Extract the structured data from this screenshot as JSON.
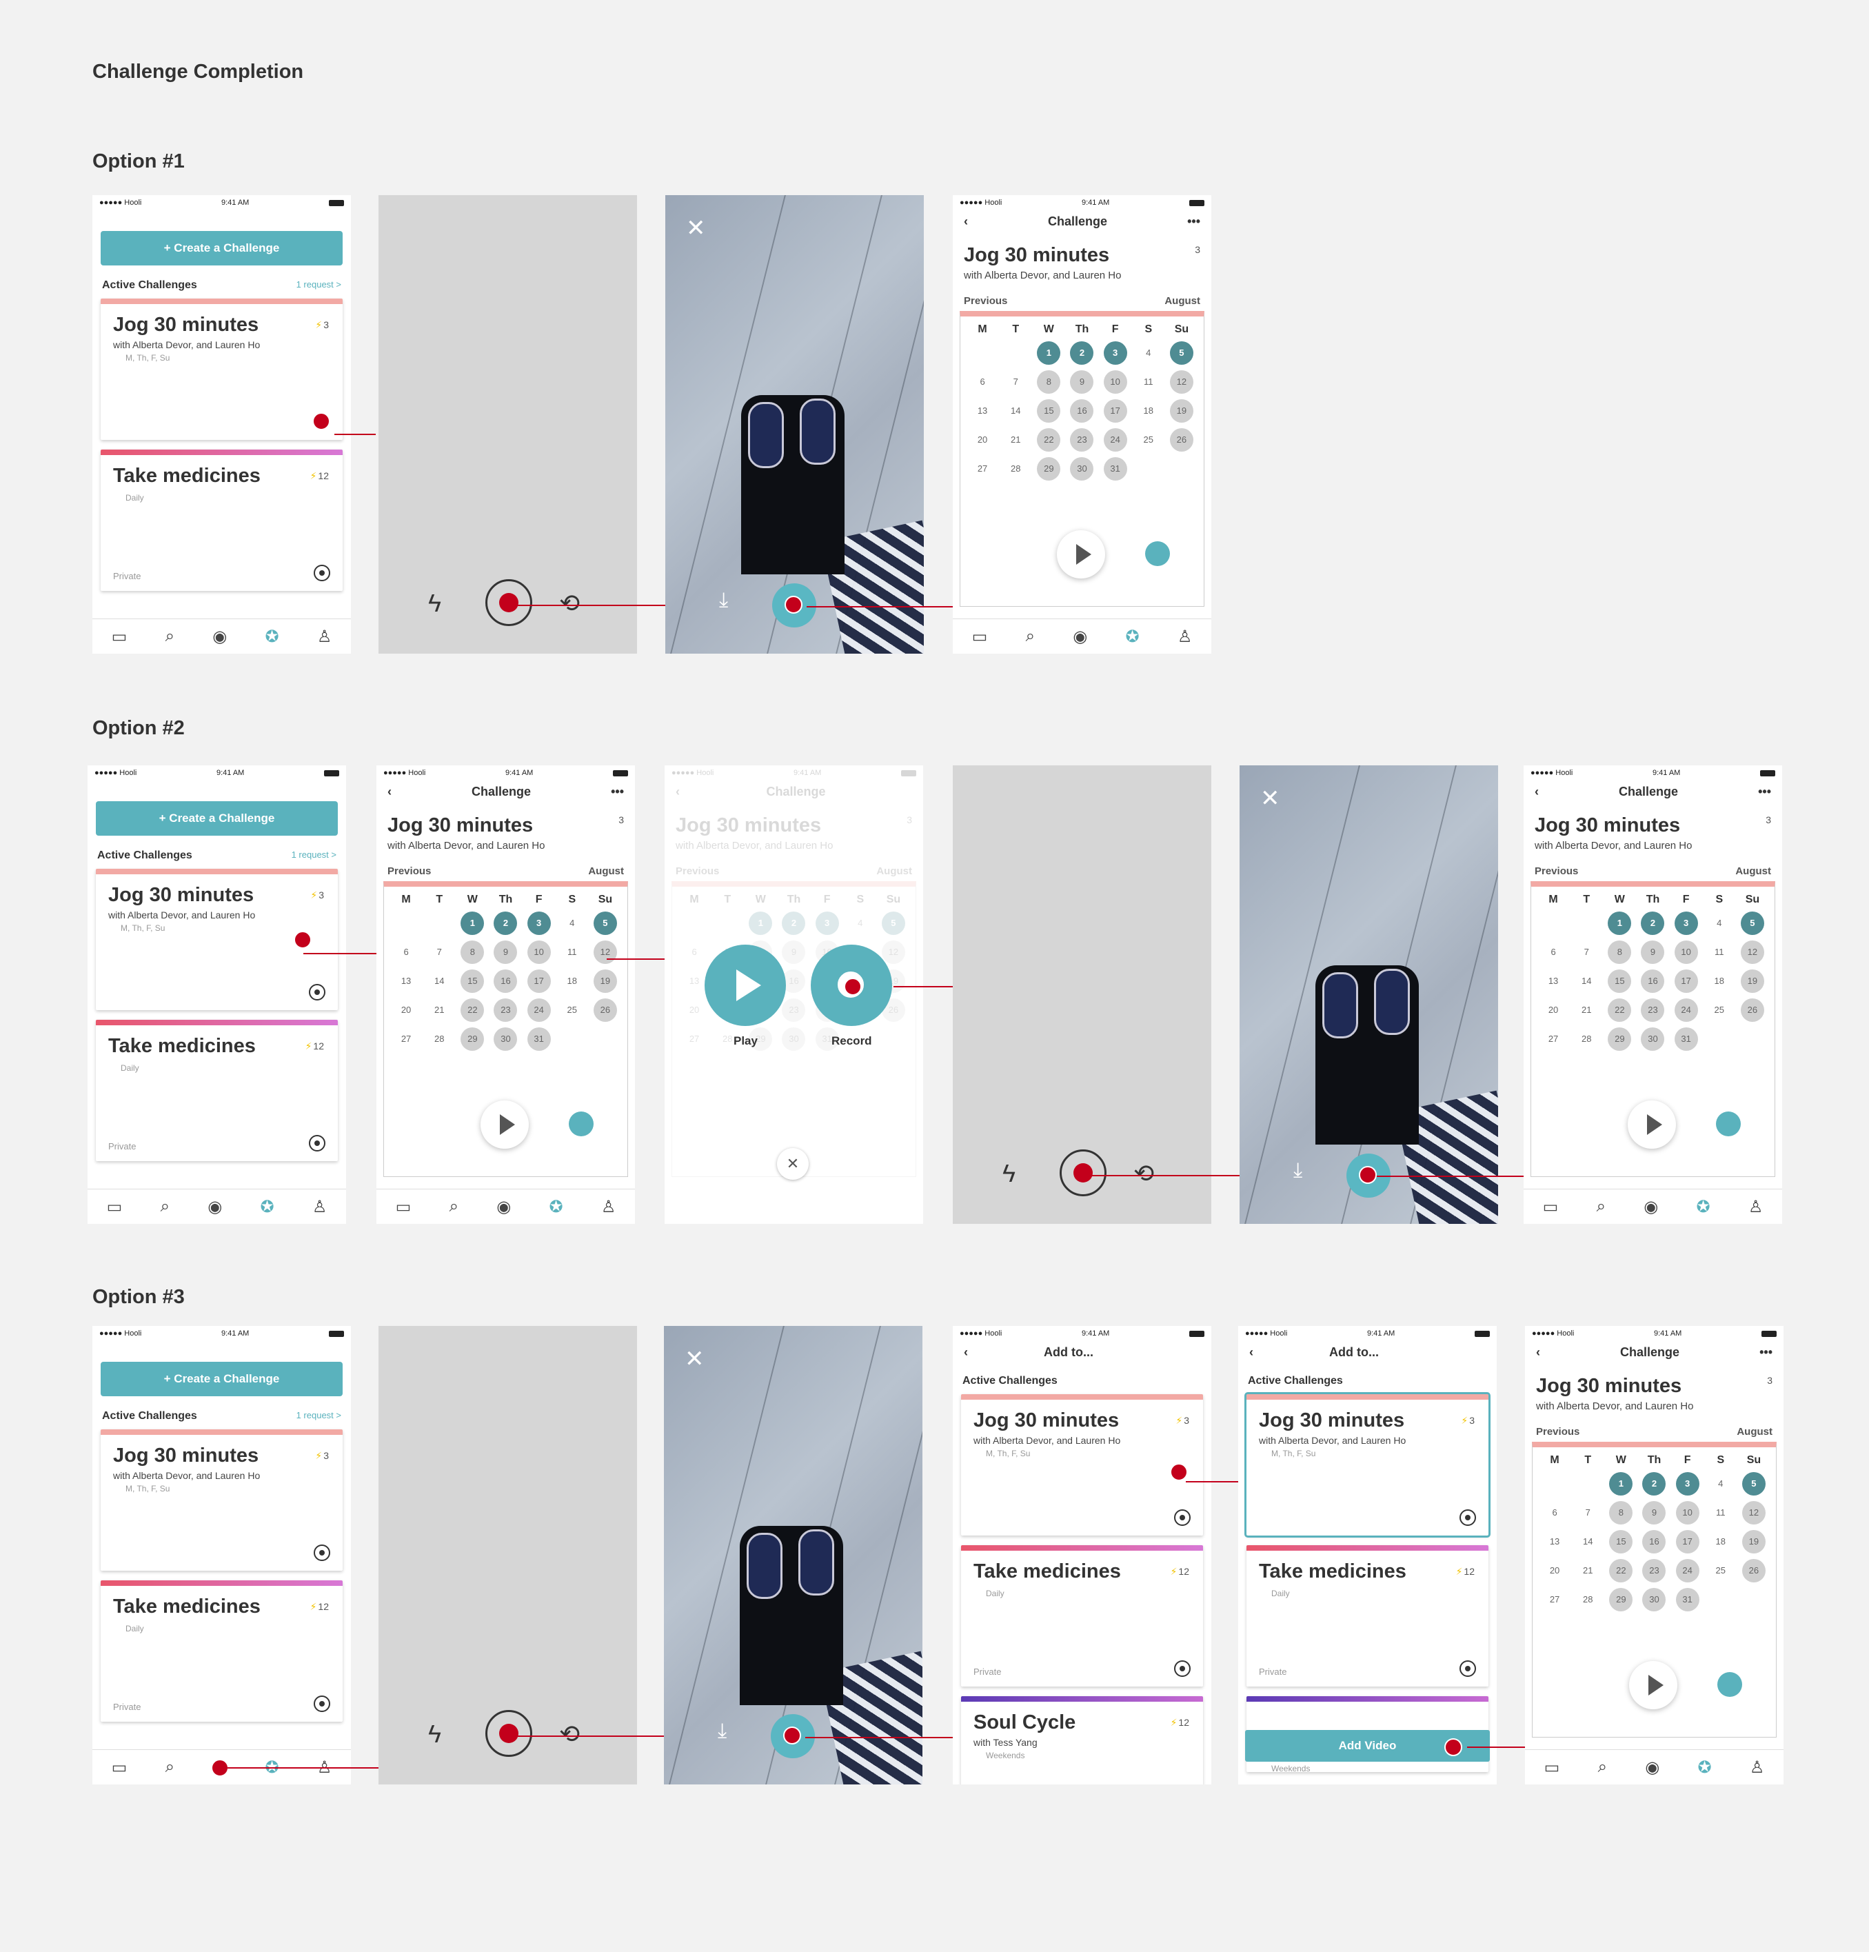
{
  "page": {
    "title": "Challenge Completion"
  },
  "options": [
    "Option #1",
    "Option #2",
    "Option #3"
  ],
  "status": {
    "carrier": "●●●●● Hooli ",
    "time": "9:41 AM"
  },
  "home": {
    "create": "+ Create a Challenge",
    "section": "Active Challenges",
    "requests": "1 request >"
  },
  "jog": {
    "title": "Jog 30 minutes",
    "with": "with Alberta Devor, and Lauren Ho",
    "days": "M, Th, F, Su",
    "points": "3"
  },
  "meds": {
    "title": "Take medicines",
    "schedule": "Daily",
    "points": "12",
    "privacy": "Private"
  },
  "soul": {
    "title": "Soul Cycle",
    "with": "with Tess Yang",
    "schedule": "Weekends",
    "points": "12"
  },
  "challenge": {
    "nav_title": "Challenge",
    "previous": "Previous",
    "month": "August"
  },
  "calendar": {
    "headers": [
      "M",
      "T",
      "W",
      "Th",
      "F",
      "S",
      "Su"
    ],
    "days": [
      "",
      "",
      "1",
      "2",
      "3",
      "4",
      "5",
      "6",
      "7",
      "8",
      "9",
      "10",
      "11",
      "12",
      "13",
      "14",
      "15",
      "16",
      "17",
      "18",
      "19",
      "20",
      "21",
      "22",
      "23",
      "24",
      "25",
      "26",
      "27",
      "28",
      "29",
      "30",
      "31",
      "",
      "",
      ""
    ],
    "completed": [
      "1",
      "2",
      "3",
      "5"
    ]
  },
  "popup": {
    "play": "Play",
    "record": "Record"
  },
  "addto": {
    "nav_title": "Add to...",
    "section": "Active Challenges",
    "button": "Add Video"
  },
  "icons": {
    "tabs": [
      "calendar-icon",
      "search-icon",
      "record-icon",
      "discover-icon",
      "profile-icon"
    ],
    "camera": [
      "flash-icon",
      "record-button",
      "flip-camera-icon"
    ]
  },
  "colors": {
    "accent": "#5ab2bd",
    "hotspot": "#c3001b",
    "completed_day": "#4f8c93"
  }
}
